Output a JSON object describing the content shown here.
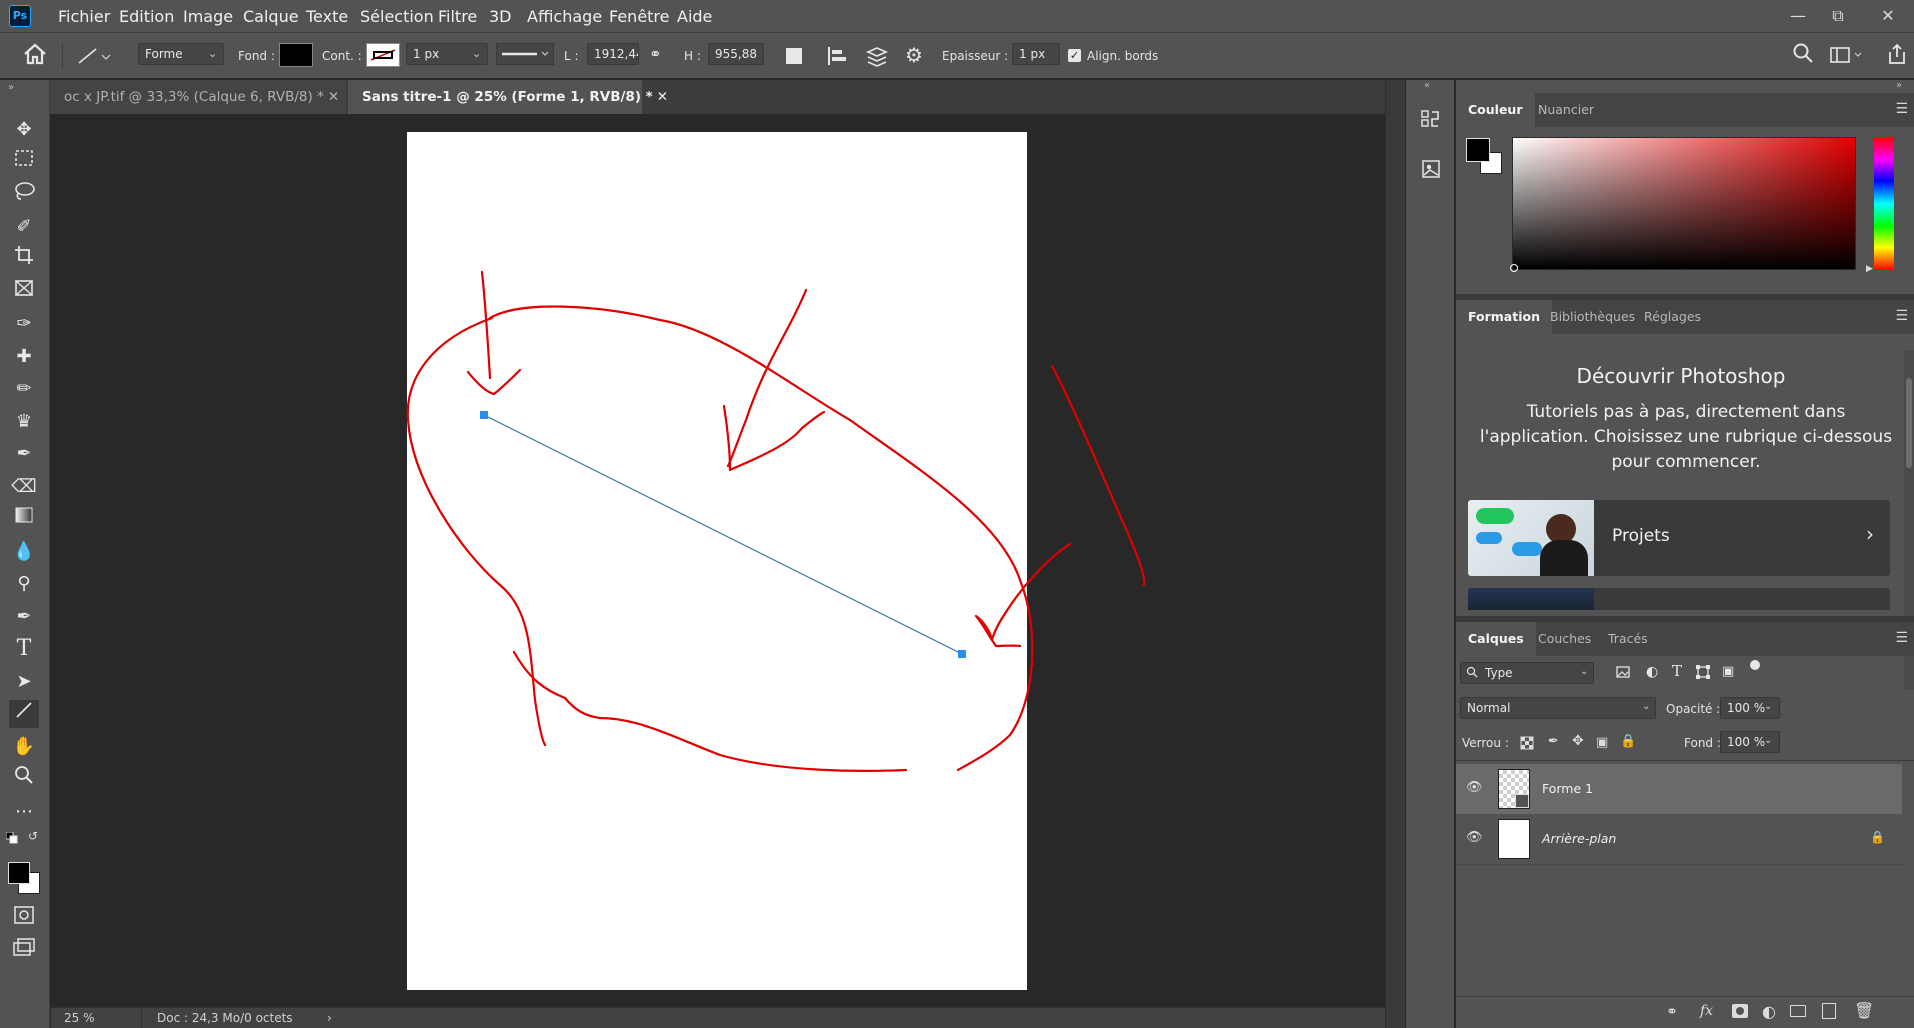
{
  "app": {
    "logo": "Ps"
  },
  "menu": [
    "Fichier",
    "Edition",
    "Image",
    "Calque",
    "Texte",
    "Sélection",
    "Filtre",
    "3D",
    "Affichage",
    "Fenêtre",
    "Aide"
  ],
  "options": {
    "mode": "Forme",
    "fill_label": "Fond :",
    "stroke_label": "Cont. :",
    "stroke_width": "1 px",
    "w_label": "L :",
    "w_value": "1912,44",
    "h_label": "H :",
    "h_value": "955,88",
    "weight_label": "Epaisseur :",
    "weight_value": "1 px",
    "align_edges": "Align. bords"
  },
  "tabs": [
    {
      "label": "oc x JP.tif @ 33,3% (Calque 6, RVB/8) *",
      "active": false
    },
    {
      "label": "Sans titre-1 @ 25% (Forme 1, RVB/8) *",
      "active": true
    }
  ],
  "status": {
    "zoom": "25 %",
    "doc": "Doc : 24,3 Mo/0 octets",
    "arrow": "›"
  },
  "color_panel": {
    "tabs": [
      "Couleur",
      "Nuancier"
    ],
    "foreground": "#000000",
    "background": "#ffffff"
  },
  "learn_panel": {
    "tabs": [
      "Formation",
      "Bibliothèques",
      "Réglages"
    ],
    "title": "Découvrir Photoshop",
    "description": "Tutoriels pas à pas, directement dans l'application. Choisissez une rubrique ci-dessous pour commencer.",
    "card_label": "Projets"
  },
  "layers_panel": {
    "tabs": [
      "Calques",
      "Couches",
      "Tracés"
    ],
    "filter": "Type",
    "blend_mode": "Normal",
    "opacity_label": "Opacité :",
    "opacity_value": "100 %",
    "lock_label": "Verrou :",
    "fill_label": "Fond :",
    "fill_value": "100 %",
    "layers": [
      {
        "name": "Forme 1",
        "selected": true
      },
      {
        "name": "Arrière-plan",
        "selected": false
      }
    ]
  },
  "colors": {
    "accent": "#31a8ff",
    "annotation": "#e00000",
    "line": "#3a6fa8"
  }
}
